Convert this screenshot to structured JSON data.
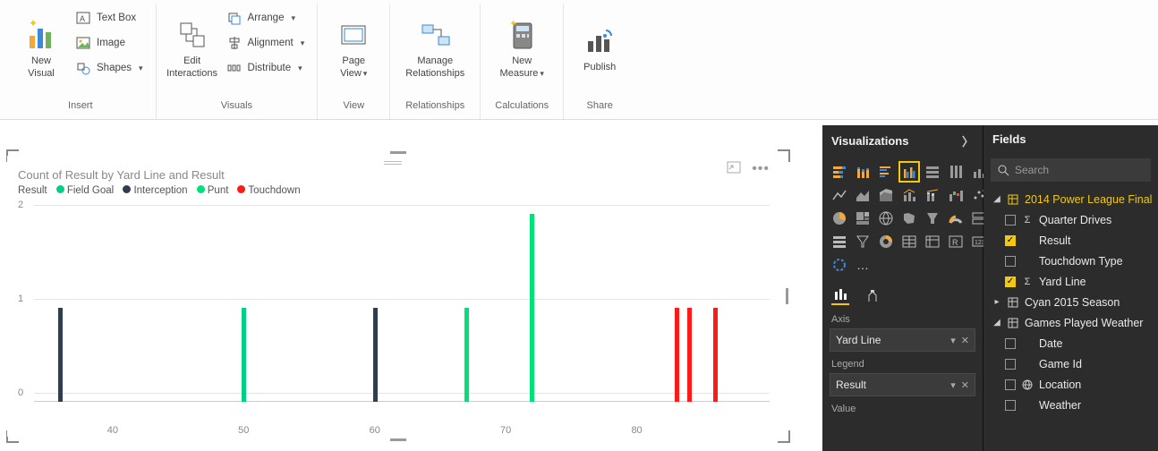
{
  "ribbon": {
    "groups": {
      "insert": {
        "label": "Insert",
        "new_visual": "New\nVisual",
        "text_box": "Text Box",
        "image": "Image",
        "shapes": "Shapes"
      },
      "visuals": {
        "label": "Visuals",
        "edit_interactions": "Edit\nInteractions",
        "arrange": "Arrange",
        "alignment": "Alignment",
        "distribute": "Distribute"
      },
      "view": {
        "label": "View",
        "page_view": "Page\nView"
      },
      "relationships": {
        "label": "Relationships",
        "manage": "Manage\nRelationships"
      },
      "calculations": {
        "label": "Calculations",
        "new_measure": "New\nMeasure"
      },
      "share": {
        "label": "Share",
        "publish": "Publish"
      }
    }
  },
  "chart": {
    "title": "Count of Result by Yard Line and Result",
    "legend_title": "Result",
    "legend": [
      {
        "label": "Field Goal",
        "color": "#00d084"
      },
      {
        "label": "Interception",
        "color": "#2c3e50"
      },
      {
        "label": "Punt",
        "color": "#00e07a"
      },
      {
        "label": "Touchdown",
        "color": "#ff1a1a"
      }
    ]
  },
  "chart_data": {
    "type": "bar",
    "xlabel": "",
    "ylabel": "",
    "ylim": [
      0,
      2
    ],
    "y_ticks": [
      0,
      1,
      2
    ],
    "x_ticks": [
      40,
      50,
      60,
      70,
      80
    ],
    "series": [
      {
        "name": "Interception",
        "color": "#2c3e50",
        "points": [
          {
            "x": 36,
            "y": 1
          },
          {
            "x": 60,
            "y": 1
          }
        ]
      },
      {
        "name": "Field Goal",
        "color": "#00d084",
        "points": [
          {
            "x": 50,
            "y": 1
          }
        ]
      },
      {
        "name": "Punt",
        "color": "#00e07a",
        "points": [
          {
            "x": 67,
            "y": 1
          },
          {
            "x": 72,
            "y": 2
          }
        ]
      },
      {
        "name": "Touchdown",
        "color": "#ff1a1a",
        "points": [
          {
            "x": 83,
            "y": 1
          },
          {
            "x": 84,
            "y": 1
          },
          {
            "x": 86,
            "y": 1
          }
        ]
      }
    ]
  },
  "viz_pane": {
    "title": "Visualizations",
    "wells": {
      "axis": {
        "label": "Axis",
        "value": "Yard Line"
      },
      "legend": {
        "label": "Legend",
        "value": "Result"
      },
      "value": {
        "label": "Value"
      }
    }
  },
  "fields_pane": {
    "title": "Fields",
    "search_placeholder": "Search",
    "tree": {
      "t1": {
        "name": "2014 Power League Final",
        "expanded": true
      },
      "t1_f1": {
        "name": "Quarter Drives",
        "checked": false,
        "sigma": true
      },
      "t1_f2": {
        "name": "Result",
        "checked": true
      },
      "t1_f3": {
        "name": "Touchdown Type",
        "checked": false
      },
      "t1_f4": {
        "name": "Yard Line",
        "checked": true,
        "sigma": true
      },
      "t2": {
        "name": "Cyan 2015 Season",
        "expanded": false
      },
      "t3": {
        "name": "Games Played Weather",
        "expanded": true
      },
      "t3_f1": {
        "name": "Date",
        "checked": false
      },
      "t3_f2": {
        "name": "Game Id",
        "checked": false
      },
      "t3_f3": {
        "name": "Location",
        "checked": false,
        "globe": true
      },
      "t3_f4": {
        "name": "Weather",
        "checked": false
      }
    }
  }
}
